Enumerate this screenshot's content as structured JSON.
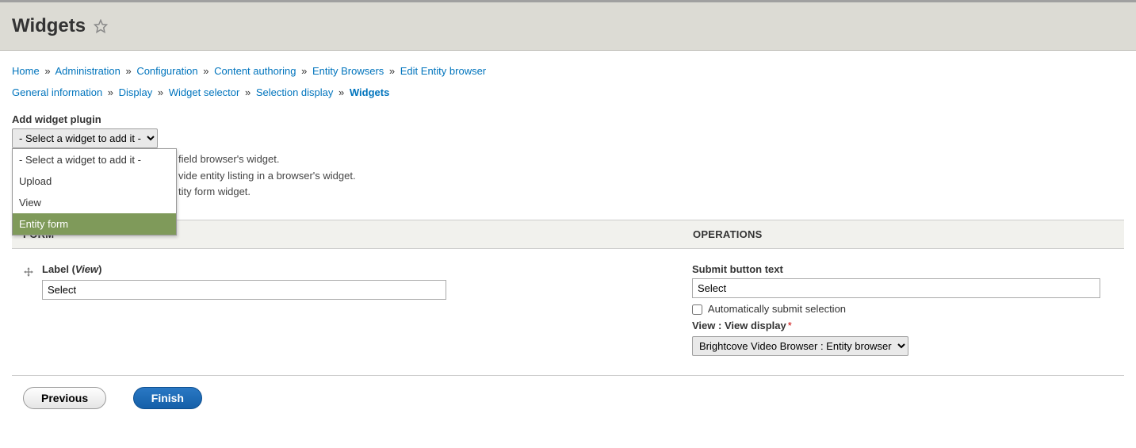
{
  "header": {
    "title": "Widgets"
  },
  "breadcrumb_top": [
    {
      "label": "Home"
    },
    {
      "label": "Administration"
    },
    {
      "label": "Configuration"
    },
    {
      "label": "Content authoring"
    },
    {
      "label": "Entity Browsers"
    },
    {
      "label": "Edit Entity browser"
    }
  ],
  "breadcrumb_steps": [
    {
      "label": "General information"
    },
    {
      "label": "Display"
    },
    {
      "label": "Widget selector"
    },
    {
      "label": "Selection display"
    }
  ],
  "breadcrumb_current": "Widgets",
  "add_widget": {
    "label": "Add widget plugin",
    "selected": "- Select a widget to add it -",
    "options": [
      "- Select a widget to add it -",
      "Upload",
      "View",
      "Entity form"
    ],
    "highlighted_index": 3
  },
  "help_text": {
    "line1_suffix": " field browser's widget.",
    "line2_suffix": "vide entity listing in a browser's widget.",
    "line3_suffix": "tity form widget."
  },
  "table": {
    "col_form": "FORM",
    "col_ops": "OPERATIONS"
  },
  "row": {
    "label_prefix": "Label (",
    "label_italic": "View",
    "label_suffix": ")",
    "label_value": "Select"
  },
  "ops": {
    "submit_label": "Submit button text",
    "submit_value": "Select",
    "auto_submit_label": " Automatically submit selection",
    "view_label": "View : View display",
    "view_selected": "Brightcove Video Browser : Entity browser"
  },
  "actions": {
    "previous": "Previous",
    "finish": "Finish"
  }
}
